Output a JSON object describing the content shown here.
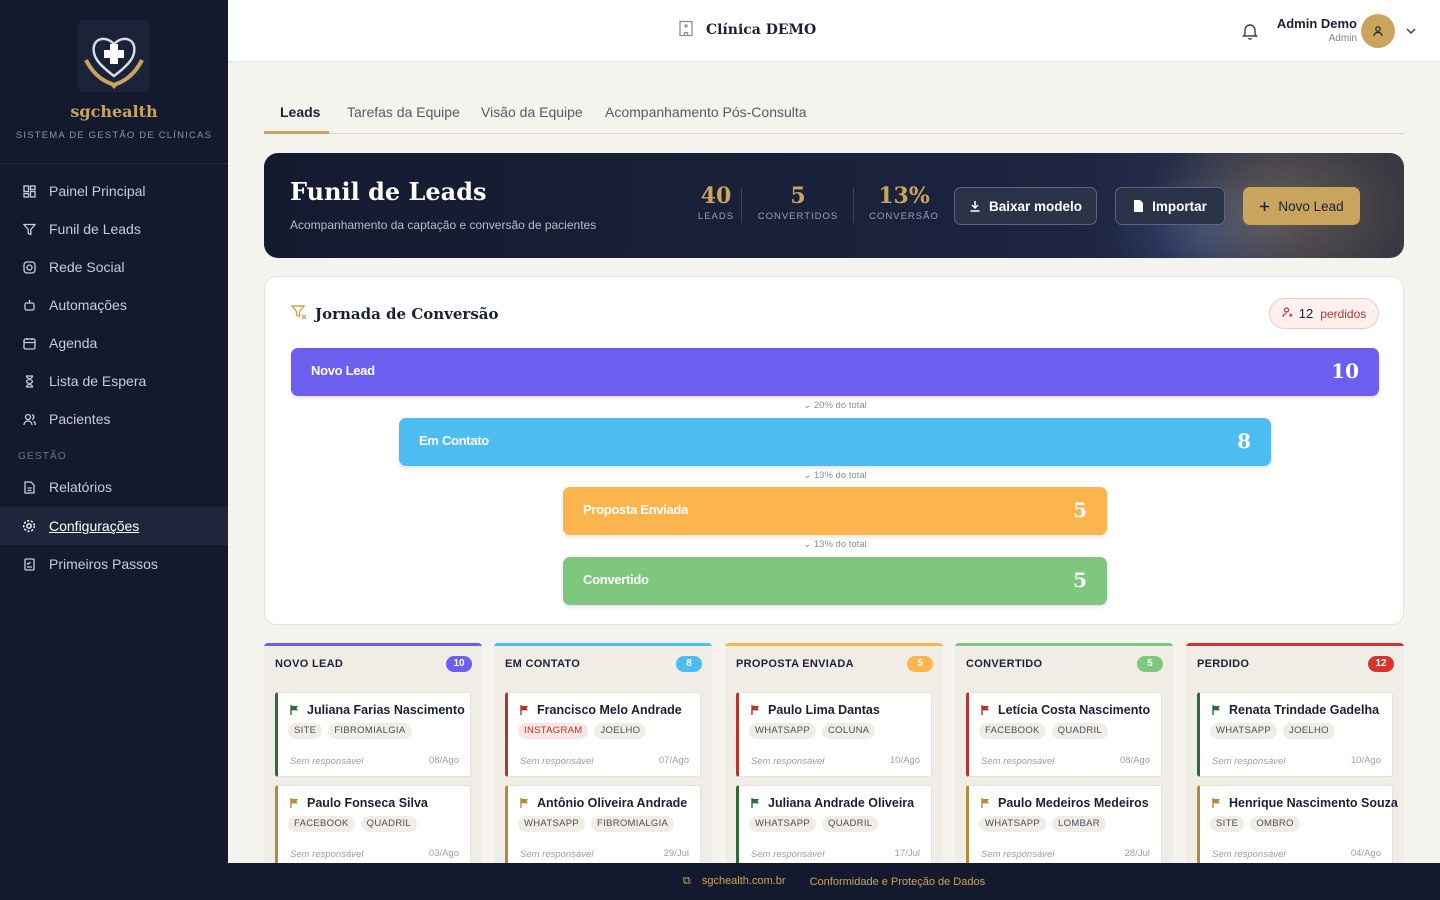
{
  "brand": {
    "name": "sgchealth",
    "subtitle": "SISTEMA DE GESTÃO DE CLÍNICAS"
  },
  "sidebar": {
    "items": [
      {
        "label": "Painel Principal",
        "icon": "dashboard-icon"
      },
      {
        "label": "Funil de Leads",
        "icon": "funnel-icon"
      },
      {
        "label": "Rede Social",
        "icon": "instagram-icon"
      },
      {
        "label": "Automações",
        "icon": "robot-icon"
      },
      {
        "label": "Agenda",
        "icon": "calendar-icon"
      },
      {
        "label": "Lista de Espera",
        "icon": "hourglass-icon"
      },
      {
        "label": "Pacientes",
        "icon": "users-icon"
      }
    ],
    "section_label": "GESTÃO",
    "section_items": [
      {
        "label": "Relatórios",
        "icon": "report-icon"
      },
      {
        "label": "Configurações",
        "icon": "gear-icon",
        "active": true
      },
      {
        "label": "Primeiros Passos",
        "icon": "checklist-icon"
      }
    ]
  },
  "topbar": {
    "clinic": "Clínica DEMO",
    "user_name": "Admin Demo",
    "user_role": "Admin"
  },
  "tabs": [
    "Leads",
    "Tarefas da Equipe",
    "Visão da Equipe",
    "Acompanhamento Pós-Consulta"
  ],
  "hero": {
    "title": "Funil de Leads",
    "subtitle": "Acompanhamento da captação e conversão de pacientes",
    "stats": [
      {
        "value": "40",
        "label": "LEADS"
      },
      {
        "value": "5",
        "label": "CONVERTIDOS"
      },
      {
        "value": "13%",
        "label": "CONVERSÃO"
      }
    ],
    "buttons": {
      "download": "Baixar modelo",
      "import": "Importar",
      "new": "Novo Lead"
    }
  },
  "journey": {
    "title": "Jornada de Conversão",
    "lost_count": "12",
    "lost_label": "perdidos",
    "stages": [
      {
        "name": "Novo Lead",
        "count": "10",
        "color": "#6c5ff0"
      },
      {
        "name": "Em Contato",
        "count": "8",
        "color": "#4dbcf0"
      },
      {
        "name": "Proposta Enviada",
        "count": "5",
        "color": "#fbb54c"
      },
      {
        "name": "Convertido",
        "count": "5",
        "color": "#7fc67f"
      }
    ],
    "percentages": [
      "20% do total",
      "13% do total",
      "13% do total"
    ]
  },
  "kanban": [
    {
      "title": "NOVO LEAD",
      "count": "10",
      "color": "#6c5ff0",
      "cards": [
        {
          "name": "Juliana Farias Nascimento",
          "tags": [
            "SITE",
            "FIBROMIALGIA"
          ],
          "resp": "Sem responsável",
          "date": "08/Ago",
          "flag": "#2e6b3a"
        },
        {
          "name": "Paulo Fonseca Silva",
          "tags": [
            "FACEBOOK",
            "QUADRIL"
          ],
          "resp": "Sem responsável",
          "date": "03/Ago",
          "flag": "#b78a3a"
        }
      ]
    },
    {
      "title": "EM CONTATO",
      "count": "8",
      "color": "#4dbcf0",
      "cards": [
        {
          "name": "Francisco Melo Andrade",
          "tags": [
            "INSTAGRAM",
            "JOELHO"
          ],
          "resp": "Sem responsável",
          "date": "07/Ago",
          "flag": "#b4352c"
        },
        {
          "name": "Antônio Oliveira Andrade",
          "tags": [
            "WHATSAPP",
            "FIBROMIALGIA"
          ],
          "resp": "Sem responsável",
          "date": "29/Jul",
          "flag": "#b78a3a"
        }
      ]
    },
    {
      "title": "PROPOSTA ENVIADA",
      "count": "5",
      "color": "#fbb54c",
      "cards": [
        {
          "name": "Paulo Lima Dantas",
          "tags": [
            "WHATSAPP",
            "COLUNA"
          ],
          "resp": "Sem responsável",
          "date": "10/Ago",
          "flag": "#b4352c"
        },
        {
          "name": "Juliana Andrade Oliveira",
          "tags": [
            "WHATSAPP",
            "QUADRIL"
          ],
          "resp": "Sem responsável",
          "date": "17/Jul",
          "flag": "#2e6b3a"
        }
      ]
    },
    {
      "title": "CONVERTIDO",
      "count": "5",
      "color": "#7fc67f",
      "cards": [
        {
          "name": "Letícia Costa Nascimento",
          "tags": [
            "FACEBOOK",
            "QUADRIL"
          ],
          "resp": "Sem responsável",
          "date": "08/Ago",
          "flag": "#b4352c"
        },
        {
          "name": "Paulo Medeiros Medeiros",
          "tags": [
            "WHATSAPP",
            "LOMBAR"
          ],
          "resp": "Sem responsável",
          "date": "28/Jul",
          "flag": "#b78a3a"
        }
      ]
    },
    {
      "title": "PERDIDO",
      "count": "12",
      "color": "#d8342f",
      "cards": [
        {
          "name": "Renata Trindade Gadelha",
          "tags": [
            "WHATSAPP",
            "JOELHO"
          ],
          "resp": "Sem responsável",
          "date": "10/Ago",
          "flag": "#2e6b3a"
        },
        {
          "name": "Henrique Nascimento Souza",
          "tags": [
            "SITE",
            "OMBRO"
          ],
          "resp": "Sem responsável",
          "date": "04/Ago",
          "flag": "#b78a3a"
        }
      ]
    }
  ],
  "footer": {
    "site": "sgchealth.com.br",
    "compliance": "Conformidade e Proteção de Dados"
  }
}
